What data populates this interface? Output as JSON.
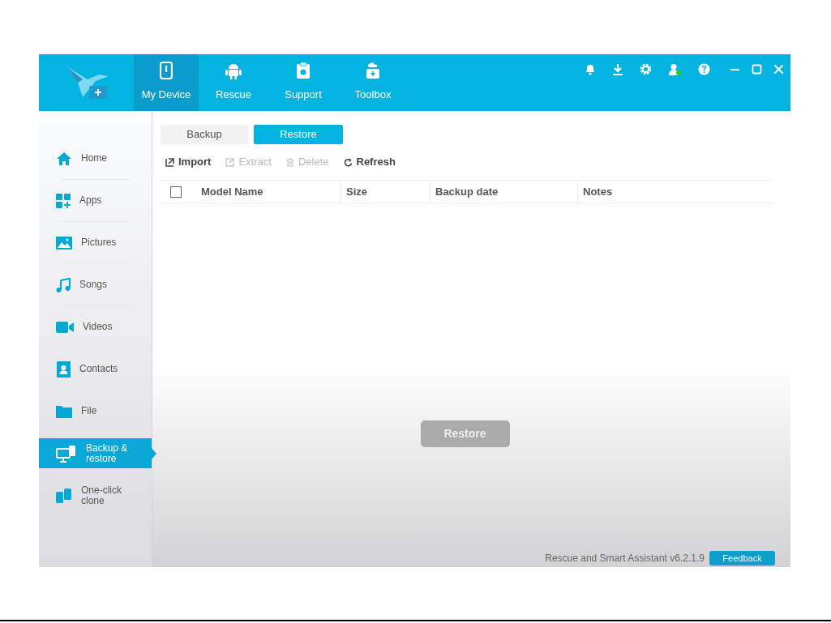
{
  "nav_tabs": [
    {
      "label": "My Device",
      "selected": true
    },
    {
      "label": "Rescue",
      "selected": false
    },
    {
      "label": "Support",
      "selected": false
    },
    {
      "label": "Toolbox",
      "selected": false
    }
  ],
  "sidebar": {
    "items": [
      {
        "label": "Home",
        "selected": false
      },
      {
        "label": "Apps",
        "selected": false
      },
      {
        "label": "Pictures",
        "selected": false
      },
      {
        "label": "Songs",
        "selected": false
      },
      {
        "label": "Videos",
        "selected": false
      },
      {
        "label": "Contacts",
        "selected": false
      },
      {
        "label": "File",
        "selected": false
      },
      {
        "label": "Backup & restore",
        "selected": true
      },
      {
        "label": "One-click clone",
        "selected": false
      }
    ]
  },
  "sub_tabs": [
    {
      "label": "Backup",
      "selected": false
    },
    {
      "label": "Restore",
      "selected": true
    }
  ],
  "toolbar": [
    {
      "label": "Import",
      "disabled": false
    },
    {
      "label": "Extract",
      "disabled": true
    },
    {
      "label": "Delete",
      "disabled": true
    },
    {
      "label": "Refresh",
      "disabled": false
    }
  ],
  "table": {
    "select_all_checked": false,
    "columns": [
      "Model Name",
      "Size",
      "Backup date",
      "Notes"
    ]
  },
  "restore_button": {
    "label": "Restore",
    "disabled": true
  },
  "status_bar": {
    "version": "Rescue and Smart Assistant v6.2.1.9",
    "feedback": "Feedback"
  }
}
